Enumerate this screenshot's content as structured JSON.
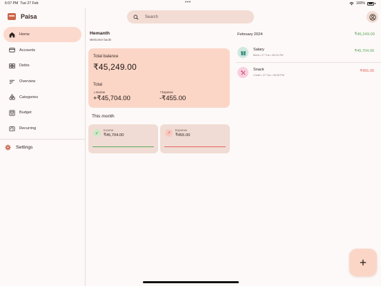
{
  "status_bar": {
    "time": "6:07 PM",
    "date": "Tue 27 Feb",
    "battery": "100%"
  },
  "app": {
    "name": "Paisa"
  },
  "sidebar": {
    "items": [
      {
        "label": "Home",
        "icon": "home-icon",
        "active": true
      },
      {
        "label": "Accounts",
        "icon": "card-icon",
        "active": false
      },
      {
        "label": "Debts",
        "icon": "debts-icon",
        "active": false
      },
      {
        "label": "Overview",
        "icon": "overview-icon",
        "active": false
      },
      {
        "label": "Categories",
        "icon": "categories-icon",
        "active": false
      },
      {
        "label": "Budget",
        "icon": "budget-icon",
        "active": false
      },
      {
        "label": "Recurring",
        "icon": "recurring-icon",
        "active": false
      }
    ],
    "settings_label": "Settings"
  },
  "search": {
    "placeholder": "Search"
  },
  "greeting": {
    "name": "Hemanth",
    "subtitle": "Welcome back!"
  },
  "balance_card": {
    "title": "Total balance",
    "value": "₹45,249.00",
    "total_label": "Total",
    "income_label": "Income",
    "income_value": "+₹45,704.00",
    "expense_label": "Expense",
    "expense_value": "-₹455.00"
  },
  "this_month": {
    "title": "This month",
    "income": {
      "label": "Income",
      "value": "₹45,704.00"
    },
    "expense": {
      "label": "Expense",
      "value": "₹455.00"
    }
  },
  "transactions": {
    "period": "February 2024",
    "period_total": "₹45,249.00",
    "items": [
      {
        "name": "Salary",
        "meta": "Bank • 27 Tue • 06:04 PM",
        "amount": "₹45,704.00",
        "type": "income",
        "icon": "gift-icon"
      },
      {
        "name": "Snack",
        "meta": "Credit • 27 Tue • 06:05 PM",
        "amount": "₹455.00",
        "type": "expense",
        "icon": "food-icon"
      }
    ]
  },
  "colors": {
    "accent": "#fbd6c7",
    "income": "#5aa55a",
    "expense": "#e0625a"
  }
}
